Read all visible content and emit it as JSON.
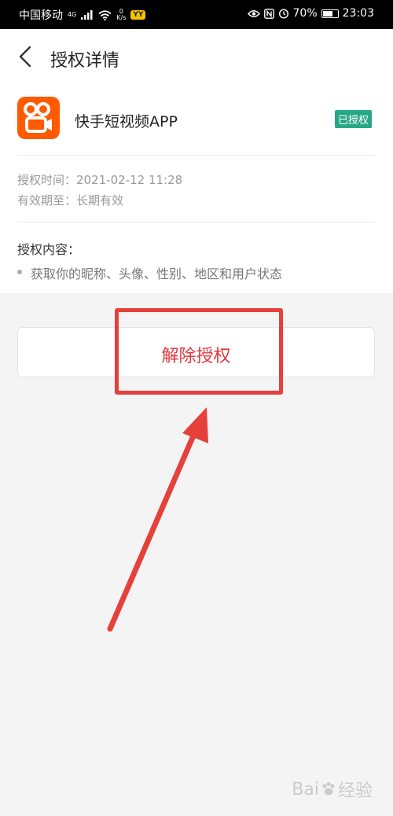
{
  "status_bar": {
    "carrier": "中国移动",
    "network": "4G",
    "speed_value": "0",
    "speed_unit": "K/s",
    "app_badge": "YY",
    "battery": "70%",
    "battery_level": 0.7,
    "time": "23:03"
  },
  "header": {
    "title": "授权详情"
  },
  "app": {
    "name": "快手短视频APP",
    "status": "已授权",
    "icon": "kuaishou-camera-logo"
  },
  "auth_info": {
    "time_label": "授权时间：",
    "time_value": "2021-02-12 11:28",
    "expiry_label": "有效期至：",
    "expiry_value": "长期有效"
  },
  "content": {
    "label": "授权内容：",
    "items": [
      "获取你的昵称、头像、性别、地区和用户状态"
    ]
  },
  "actions": {
    "revoke_label": "解除授权"
  },
  "colors": {
    "brand_orange": "#ff5a00",
    "badge_green": "#26a886",
    "revoke_red": "#e0383e",
    "annotation_red": "#e6403a"
  }
}
